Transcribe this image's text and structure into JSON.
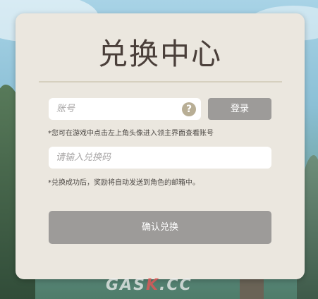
{
  "page": {
    "title": "兑换中心"
  },
  "account": {
    "placeholder": "账号",
    "help_icon": "question-circle-icon",
    "login_label": "登录",
    "hint": "*您可在游戏中点击左上角头像进入领主界面查看账号"
  },
  "redeem": {
    "placeholder": "请输入兑换码",
    "hint": "*兑换成功后，奖励将自动发送到角色的邮箱中。",
    "confirm_label": "确认兑换"
  },
  "watermark": {
    "part1": "GAS",
    "part2": "K",
    "part3": ".CC"
  },
  "colors": {
    "panel_bg": "#ebe7df",
    "title_text": "#4a3f3a",
    "button_bg": "#9d9b99",
    "help_icon_bg": "#b8ae95"
  }
}
